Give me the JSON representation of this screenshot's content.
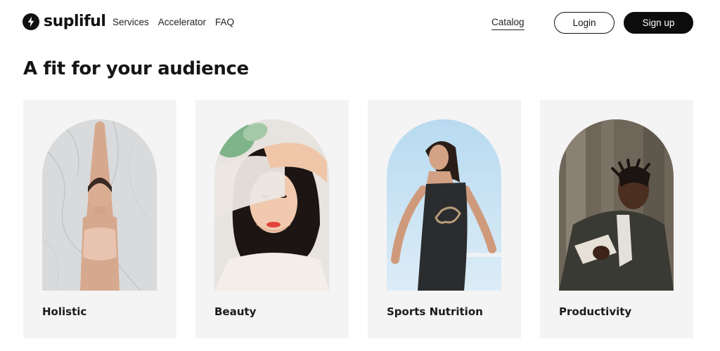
{
  "brand": {
    "name": "supliful"
  },
  "nav": {
    "links": [
      "Services",
      "Accelerator",
      "FAQ"
    ],
    "catalog": "Catalog",
    "login": "Login",
    "signup": "Sign up"
  },
  "section": {
    "title": "A fit for your audience"
  },
  "cards": [
    {
      "label": "Holistic"
    },
    {
      "label": "Beauty"
    },
    {
      "label": "Sports Nutrition"
    },
    {
      "label": "Productivity"
    }
  ],
  "colors": {
    "accent": "#0c0c0c",
    "card_bg": "#f4f4f4",
    "page_bg": "#ffffff"
  }
}
